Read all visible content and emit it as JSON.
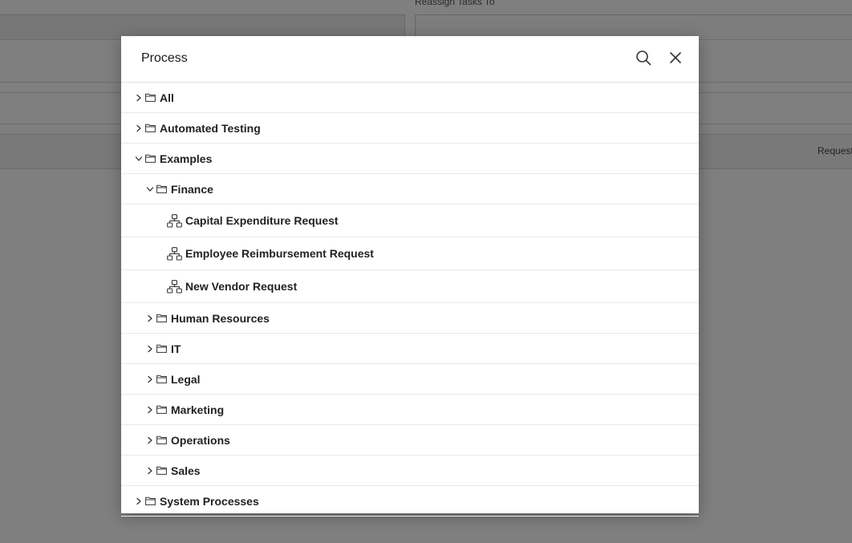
{
  "background": {
    "field_label": "Reassign Tasks To",
    "column_label": "Request"
  },
  "modal": {
    "title": "Process",
    "tree": [
      {
        "label": "All",
        "kind": "folder",
        "level": 0,
        "expanded": false
      },
      {
        "label": "Automated Testing",
        "kind": "folder",
        "level": 0,
        "expanded": false
      },
      {
        "label": "Examples",
        "kind": "folder",
        "level": 0,
        "expanded": true
      },
      {
        "label": "Finance",
        "kind": "folder",
        "level": 1,
        "expanded": true
      },
      {
        "label": "Capital Expenditure Request",
        "kind": "process",
        "level": 2
      },
      {
        "label": "Employee Reimbursement Request",
        "kind": "process",
        "level": 2
      },
      {
        "label": "New Vendor Request",
        "kind": "process",
        "level": 2
      },
      {
        "label": "Human Resources",
        "kind": "folder",
        "level": 1,
        "expanded": false
      },
      {
        "label": "IT",
        "kind": "folder",
        "level": 1,
        "expanded": false
      },
      {
        "label": "Legal",
        "kind": "folder",
        "level": 1,
        "expanded": false
      },
      {
        "label": "Marketing",
        "kind": "folder",
        "level": 1,
        "expanded": false
      },
      {
        "label": "Operations",
        "kind": "folder",
        "level": 1,
        "expanded": false
      },
      {
        "label": "Sales",
        "kind": "folder",
        "level": 1,
        "expanded": false
      },
      {
        "label": "System Processes",
        "kind": "folder",
        "level": 0,
        "expanded": false
      }
    ]
  },
  "icons": {
    "search": "search-icon",
    "close": "close-icon",
    "folder": "folder-icon",
    "process": "process-flow-icon",
    "chevron_right": "chevron-right-icon",
    "chevron_down": "chevron-down-icon"
  }
}
